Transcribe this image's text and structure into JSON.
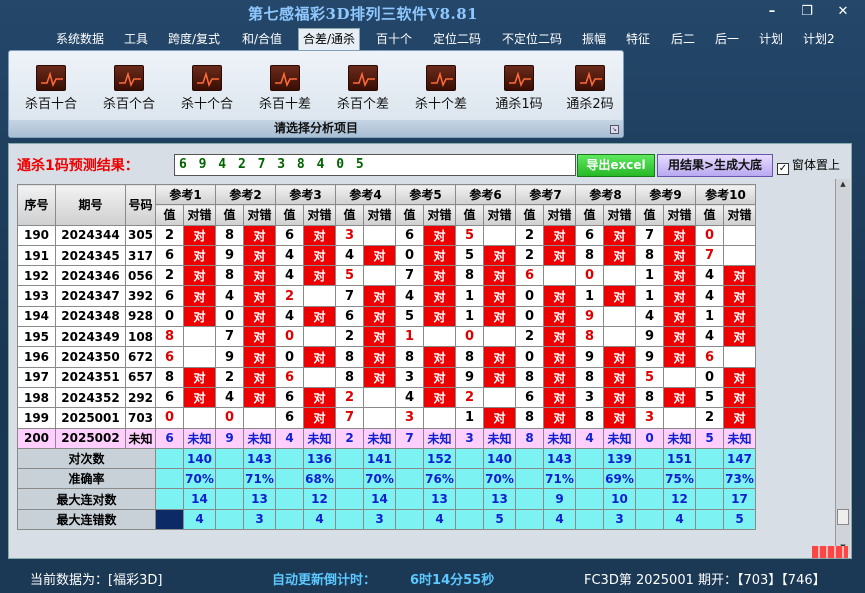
{
  "window": {
    "title": "第七感福彩3D排列三软件V8.81",
    "controls": [
      "–",
      "❐",
      "✕"
    ]
  },
  "menu": {
    "items": [
      "系统数据",
      "工具",
      "跨度/复式",
      "和/合值",
      "合差/通杀",
      "百十个",
      "定位二码",
      "不定位二码",
      "振幅",
      "特征",
      "后二",
      "后一",
      "计划",
      "计划2"
    ],
    "active_index": 4
  },
  "ribbon": {
    "buttons": [
      "杀百十合",
      "杀百个合",
      "杀十个合",
      "杀百十差",
      "杀百个差",
      "杀十个差",
      "通杀1码",
      "通杀2码"
    ],
    "caption": "请选择分析项目",
    "icon": "chart-icon"
  },
  "result": {
    "label": "通杀1码预测结果：",
    "value": "6 9 4 2 7 3 8 4 0 5",
    "excel_button": "导出excel",
    "generate_button": "用结果>生成大底",
    "topmost_label": "窗体置上",
    "topmost_checked": true
  },
  "table": {
    "headers": {
      "idx": "序号",
      "period": "期号",
      "num": "号码",
      "refs": [
        "参考1",
        "参考2",
        "参考3",
        "参考4",
        "参考5",
        "参考6",
        "参考7",
        "参考8",
        "参考9",
        "参考10"
      ],
      "val": "值",
      "check": "对错"
    },
    "mark": "对",
    "rows": [
      {
        "idx": "190",
        "period": "2024344",
        "num": "305",
        "vals": [
          [
            "2",
            1
          ],
          [
            "8",
            1
          ],
          [
            "6",
            1
          ],
          [
            "3",
            0
          ],
          [
            "6",
            1
          ],
          [
            "5",
            0
          ],
          [
            "2",
            1
          ],
          [
            "6",
            1
          ],
          [
            "7",
            1
          ],
          [
            "0",
            0
          ]
        ]
      },
      {
        "idx": "191",
        "period": "2024345",
        "num": "317",
        "vals": [
          [
            "6",
            1
          ],
          [
            "9",
            1
          ],
          [
            "4",
            1
          ],
          [
            "4",
            1
          ],
          [
            "0",
            1
          ],
          [
            "5",
            1
          ],
          [
            "2",
            1
          ],
          [
            "8",
            1
          ],
          [
            "8",
            1
          ],
          [
            "7",
            0
          ]
        ]
      },
      {
        "idx": "192",
        "period": "2024346",
        "num": "056",
        "vals": [
          [
            "2",
            1
          ],
          [
            "8",
            1
          ],
          [
            "4",
            1
          ],
          [
            "5",
            0
          ],
          [
            "7",
            1
          ],
          [
            "8",
            1
          ],
          [
            "6",
            0
          ],
          [
            "0",
            0
          ],
          [
            "1",
            1
          ],
          [
            "4",
            1
          ]
        ]
      },
      {
        "idx": "193",
        "period": "2024347",
        "num": "392",
        "vals": [
          [
            "6",
            1
          ],
          [
            "4",
            1
          ],
          [
            "2",
            0
          ],
          [
            "7",
            1
          ],
          [
            "4",
            1
          ],
          [
            "1",
            1
          ],
          [
            "0",
            1
          ],
          [
            "1",
            1
          ],
          [
            "1",
            1
          ],
          [
            "4",
            1
          ]
        ]
      },
      {
        "idx": "194",
        "period": "2024348",
        "num": "928",
        "vals": [
          [
            "0",
            1
          ],
          [
            "0",
            1
          ],
          [
            "4",
            1
          ],
          [
            "6",
            1
          ],
          [
            "5",
            1
          ],
          [
            "1",
            1
          ],
          [
            "0",
            1
          ],
          [
            "9",
            0
          ],
          [
            "4",
            1
          ],
          [
            "1",
            1
          ]
        ]
      },
      {
        "idx": "195",
        "period": "2024349",
        "num": "108",
        "vals": [
          [
            "8",
            0
          ],
          [
            "7",
            1
          ],
          [
            "0",
            0
          ],
          [
            "2",
            1
          ],
          [
            "1",
            0
          ],
          [
            "0",
            0
          ],
          [
            "2",
            1
          ],
          [
            "8",
            0
          ],
          [
            "9",
            1
          ],
          [
            "4",
            1
          ]
        ]
      },
      {
        "idx": "196",
        "period": "2024350",
        "num": "672",
        "vals": [
          [
            "6",
            0
          ],
          [
            "9",
            1
          ],
          [
            "0",
            1
          ],
          [
            "8",
            1
          ],
          [
            "8",
            1
          ],
          [
            "8",
            1
          ],
          [
            "0",
            1
          ],
          [
            "9",
            1
          ],
          [
            "9",
            1
          ],
          [
            "6",
            0
          ]
        ]
      },
      {
        "idx": "197",
        "period": "2024351",
        "num": "657",
        "vals": [
          [
            "8",
            1
          ],
          [
            "2",
            1
          ],
          [
            "6",
            0
          ],
          [
            "8",
            1
          ],
          [
            "3",
            1
          ],
          [
            "9",
            1
          ],
          [
            "8",
            1
          ],
          [
            "8",
            1
          ],
          [
            "5",
            0
          ],
          [
            "0",
            1
          ]
        ]
      },
      {
        "idx": "198",
        "period": "2024352",
        "num": "292",
        "vals": [
          [
            "6",
            1
          ],
          [
            "4",
            1
          ],
          [
            "6",
            1
          ],
          [
            "2",
            0
          ],
          [
            "4",
            1
          ],
          [
            "2",
            0
          ],
          [
            "6",
            1
          ],
          [
            "3",
            1
          ],
          [
            "8",
            1
          ],
          [
            "5",
            1
          ]
        ]
      },
      {
        "idx": "199",
        "period": "2025001",
        "num": "703",
        "vals": [
          [
            "0",
            0
          ],
          [
            "0",
            0
          ],
          [
            "6",
            1
          ],
          [
            "7",
            0
          ],
          [
            "3",
            0
          ],
          [
            "1",
            1
          ],
          [
            "8",
            1
          ],
          [
            "8",
            1
          ],
          [
            "3",
            0
          ],
          [
            "2",
            1
          ]
        ]
      }
    ],
    "pending": {
      "idx": "200",
      "period": "2025002",
      "num": "未知",
      "vals": [
        "6",
        "9",
        "4",
        "2",
        "7",
        "3",
        "8",
        "4",
        "0",
        "5"
      ],
      "status": "未知"
    },
    "stats": [
      {
        "label": "对次数",
        "values": [
          "140",
          "143",
          "136",
          "141",
          "152",
          "140",
          "143",
          "139",
          "151",
          "147"
        ]
      },
      {
        "label": "准确率",
        "values": [
          "70%",
          "71%",
          "68%",
          "70%",
          "76%",
          "70%",
          "71%",
          "69%",
          "75%",
          "73%"
        ]
      },
      {
        "label": "最大连对数",
        "values": [
          "14",
          "13",
          "12",
          "14",
          "13",
          "13",
          "9",
          "10",
          "12",
          "17"
        ]
      },
      {
        "label": "最大连错数",
        "values": [
          "4",
          "3",
          "4",
          "3",
          "4",
          "5",
          "4",
          "3",
          "4",
          "5"
        ]
      }
    ]
  },
  "status": {
    "current_data": "当前数据为：[福彩3D]",
    "countdown_label": "自动更新倒计时：",
    "countdown_value": "6时14分55秒",
    "draw_info": "FC3D第 2025001 期开：【703】【746】"
  },
  "colors": {
    "accent_red": "#ee0000",
    "stat_cyan": "#7df2f2",
    "pending_pink": "#ffd0ff",
    "title_blue": "#8fc8ff"
  }
}
